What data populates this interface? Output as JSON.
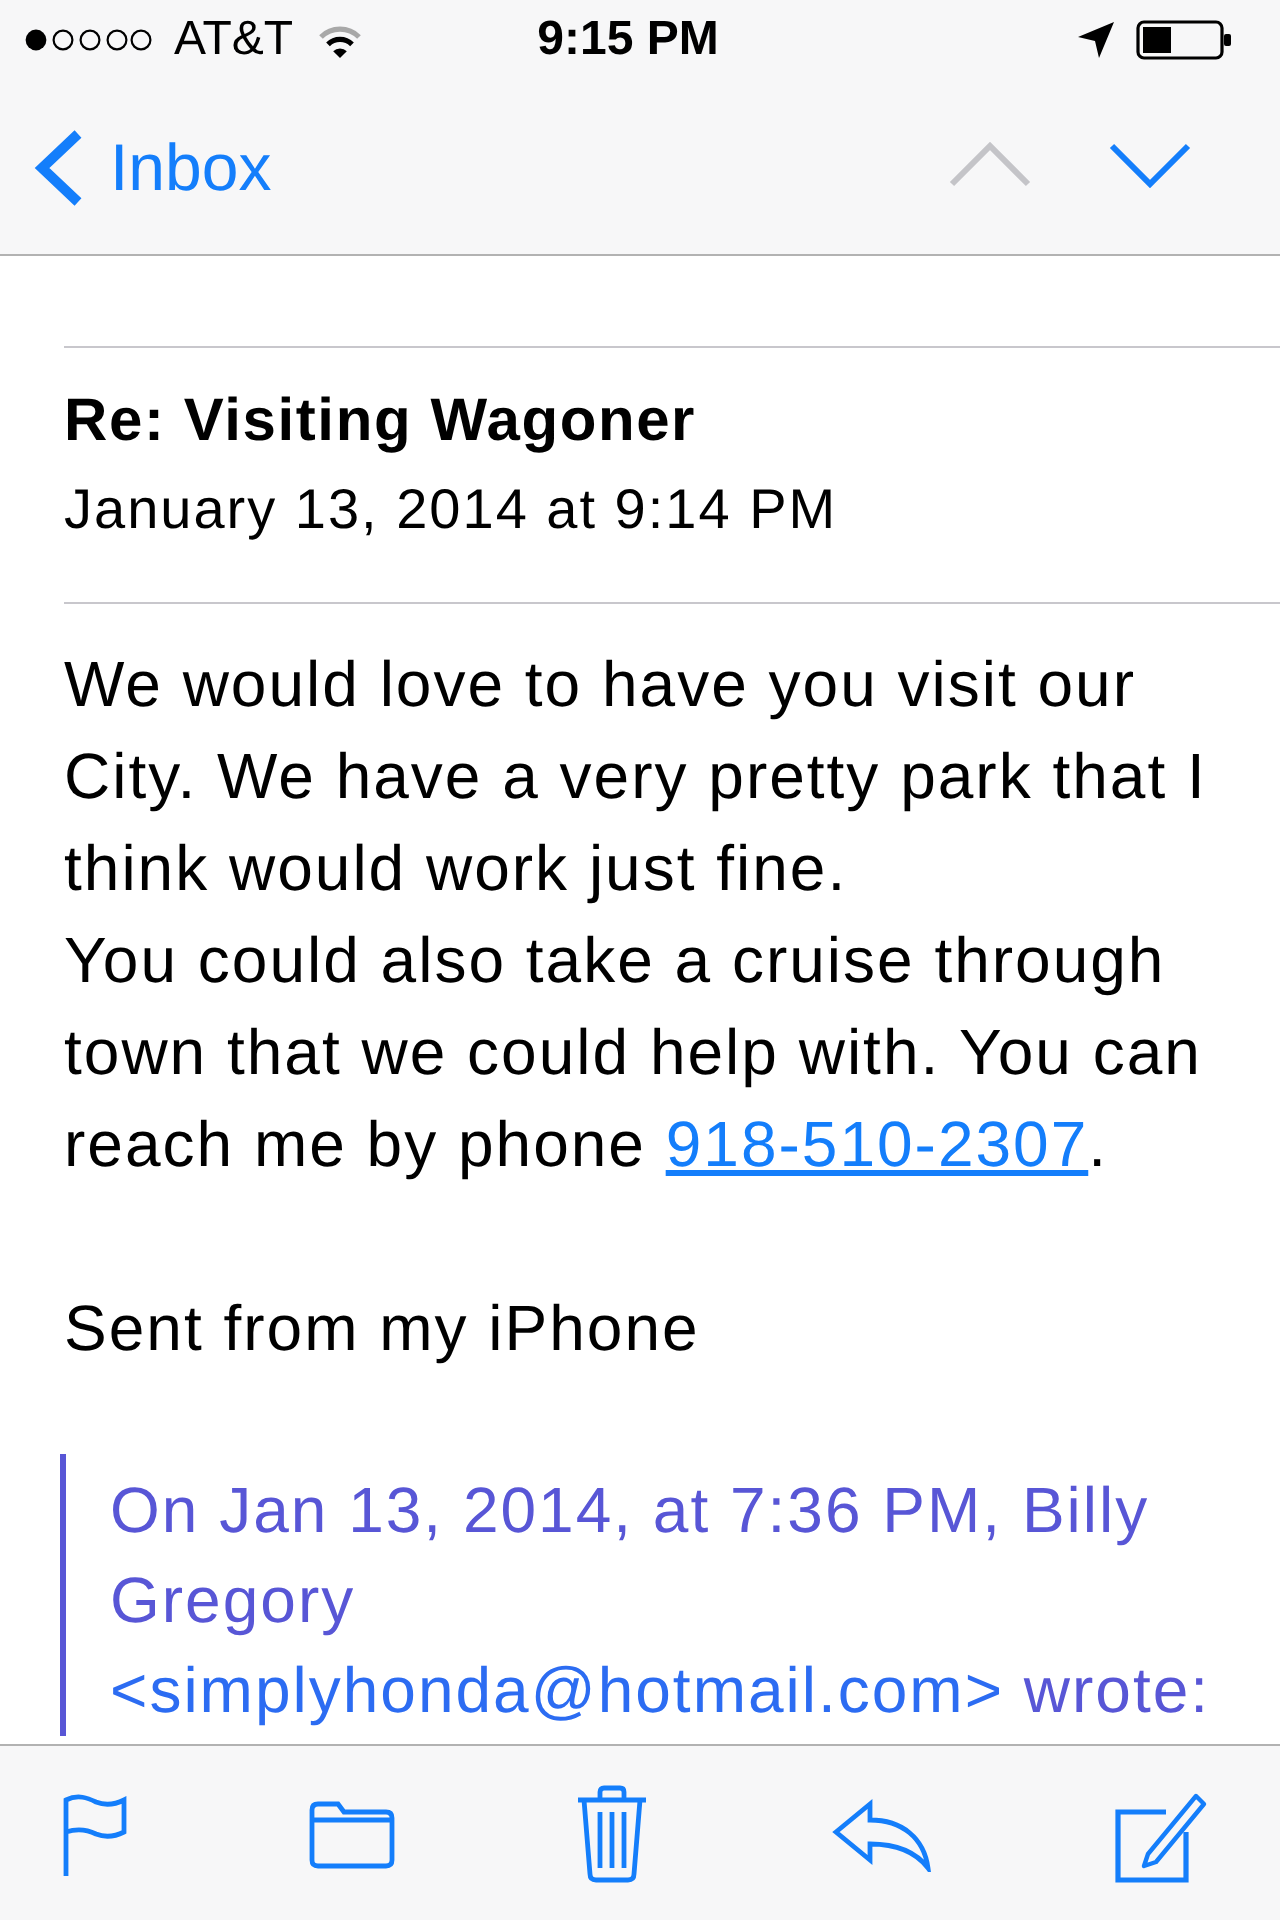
{
  "status_bar": {
    "carrier": "AT&T",
    "time": "9:15 PM"
  },
  "nav_bar": {
    "back_label": "Inbox",
    "buttons": [
      {
        "kind": "previous",
        "disabled": true
      },
      {
        "kind": "next",
        "disabled": false
      }
    ]
  },
  "message": {
    "subject": "Re: Visiting Wagoner",
    "date": "January 13, 2014 at 9:14 PM",
    "body": [
      {
        "paragraphs": [
          {
            "segments": [
              {
                "kind": "text",
                "text": "We would love to have you visit our City. We have a very pretty park that I think would work just fine."
              }
            ]
          },
          {
            "segments": [
              {
                "kind": "text",
                "text": "You could also take a cruise through town that we could help with. You can reach me by phone "
              },
              {
                "kind": "link",
                "text": "918-510-2307"
              },
              {
                "kind": "text",
                "text": "."
              }
            ]
          }
        ]
      },
      {
        "paragraphs": [
          {
            "segments": [
              {
                "kind": "text",
                "text": "Sent from my iPhone"
              }
            ]
          }
        ]
      }
    ],
    "quote": {
      "segments": [
        {
          "kind": "text",
          "text": "On Jan 13, 2014, at 7:36 PM, Billy Gregory "
        },
        {
          "kind": "link",
          "text": "<simplyhonda@hotmail.com>"
        },
        {
          "kind": "text",
          "text": " wrote:"
        }
      ]
    }
  },
  "toolbar": {
    "buttons": [
      {
        "kind": "flag"
      },
      {
        "kind": "folder"
      },
      {
        "kind": "trash"
      },
      {
        "kind": "reply"
      },
      {
        "kind": "compose"
      }
    ]
  }
}
